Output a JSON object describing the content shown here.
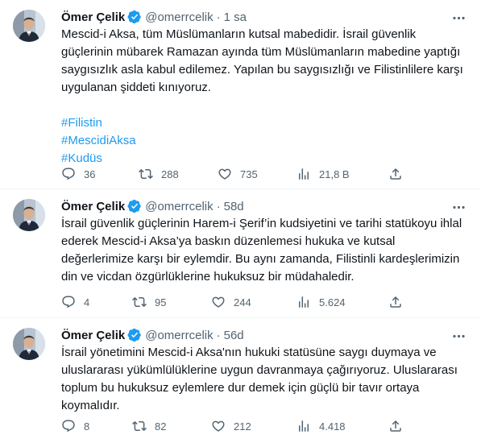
{
  "tweets": [
    {
      "name": "Ömer Çelik",
      "handle": "@omerrcelik",
      "dot": "·",
      "time": "1 sa",
      "paragraphs": [
        "Mescid-i Aksa, tüm Müslümanların kutsal mabedidir. İsrail güvenlik güçlerinin mübarek Ramazan ayında tüm Müslümanların mabedine yaptığı saygısızlık asla kabul edilemez. Yapılan bu saygısızlığı ve Filistinlilere karşı uygulanan şiddeti kınıyoruz."
      ],
      "hashtags": [
        "#Filistin",
        "#MescidiAksa",
        "#Kudüs"
      ],
      "replies": "36",
      "retweets": "288",
      "likes": "735",
      "views": "21,8 B"
    },
    {
      "name": "Ömer Çelik",
      "handle": "@omerrcelik",
      "dot": "·",
      "time": "58d",
      "paragraphs": [
        "İsrail güvenlik güçlerinin Harem-i Şerif’in kudsiyetini ve tarihi statükoyu ihlal ederek Mescid-i Aksa’ya baskın düzenlemesi hukuka ve kutsal değerlerimize karşı bir eylemdir. Bu aynı zamanda, Filistinli kardeşlerimizin din ve vicdan özgürlüklerine hukuksuz bir müdahaledir."
      ],
      "hashtags": [],
      "replies": "4",
      "retweets": "95",
      "likes": "244",
      "views": "5.624"
    },
    {
      "name": "Ömer Çelik",
      "handle": "@omerrcelik",
      "dot": "·",
      "time": "56d",
      "paragraphs": [
        "İsrail yönetimini Mescid-i Aksa'nın hukuki statüsüne saygı duymaya ve uluslararası yükümlülüklerine uygun davranmaya çağırıyoruz. Uluslararası toplum bu hukuksuz eylemlere dur demek için güçlü bir tavır ortaya koymalıdır."
      ],
      "hashtags": [],
      "replies": "8",
      "retweets": "82",
      "likes": "212",
      "views": "4.418"
    }
  ],
  "icons": {
    "verified": "verified-badge-icon",
    "more": "more-icon",
    "reply": "reply-icon",
    "retweet": "retweet-icon",
    "like": "like-icon",
    "views": "views-icon",
    "share": "share-icon"
  },
  "colors": {
    "accent": "#1d9bf0",
    "text": "#0f1419",
    "muted": "#536471",
    "divider": "#eff3f4"
  }
}
